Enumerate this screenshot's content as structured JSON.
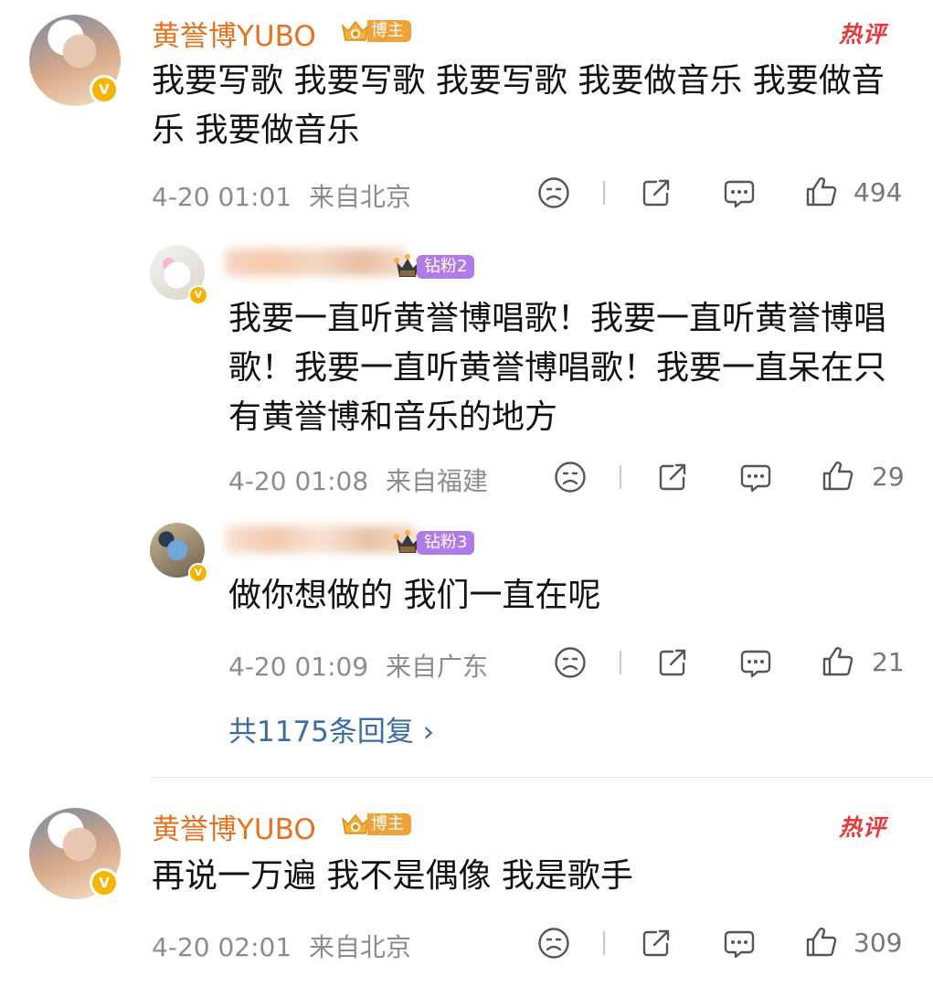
{
  "colors": {
    "author_name": "#e6721f",
    "hot": "#e8383d",
    "link": "#3b6ba5",
    "meta": "#8c8c8c"
  },
  "comments": [
    {
      "author": "黄誉博YUBO",
      "role_badge": "博主",
      "hot_label": "热评",
      "text": "我要写歌 我要写歌 我要写歌  我要做音乐 我要做音乐 我要做音乐",
      "time": "4-20 01:01",
      "location": "来自北京",
      "likes": "494"
    },
    {
      "author": "黄誉博YUBO",
      "role_badge": "博主",
      "hot_label": "热评",
      "text": "再说一万遍 我不是偶像 我是歌手",
      "time": "4-20 02:01",
      "location": "来自北京",
      "likes": "309"
    }
  ],
  "replies": [
    {
      "fan_badge": "钻粉2",
      "text": "我要一直听黄誉博唱歌！我要一直听黄誉博唱歌！我要一直听黄誉博唱歌！我要一直呆在只有黄誉博和音乐的地方",
      "time": "4-20 01:08",
      "location": "来自福建",
      "likes": "29"
    },
    {
      "fan_badge": "钻粉3",
      "text": "做你想做的 我们一直在呢",
      "time": "4-20 01:09",
      "location": "来自广东",
      "likes": "21"
    }
  ],
  "more_replies": "共1175条回复 ›",
  "icons": [
    "verified-v-icon",
    "crown-icon",
    "dislike-face-icon",
    "share-icon",
    "comment-icon",
    "thumbs-up-icon",
    "chevron-right-icon"
  ]
}
